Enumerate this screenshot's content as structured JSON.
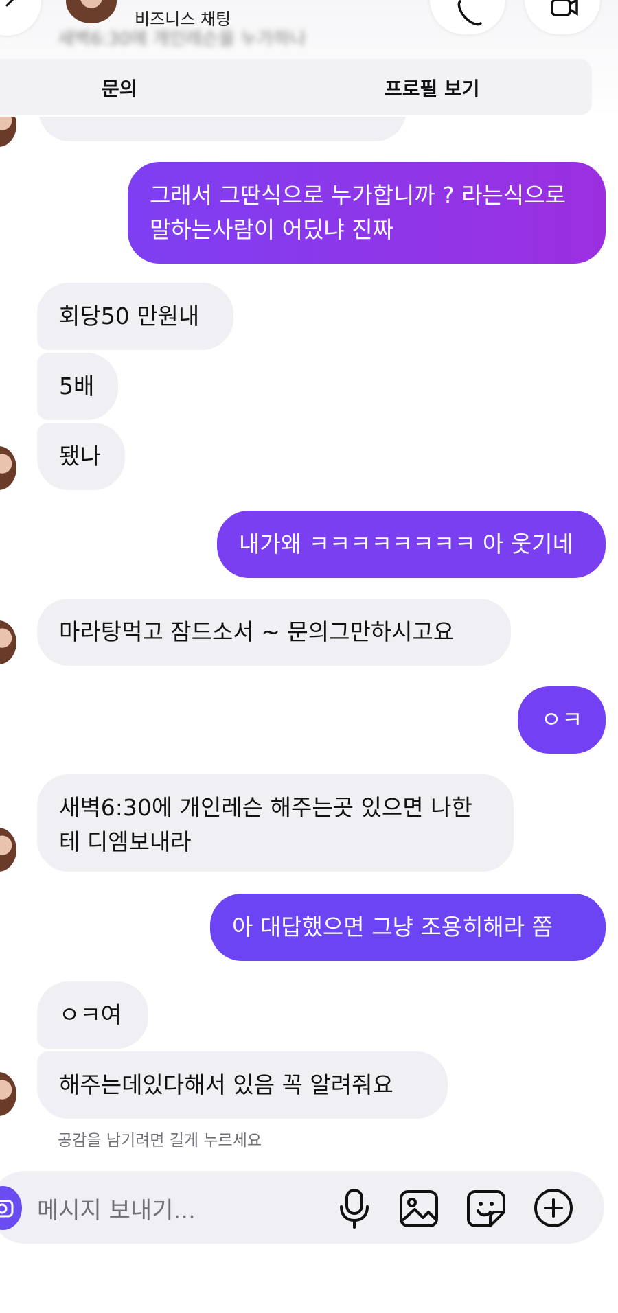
{
  "header": {
    "subtitle": "비즈니스 채팅",
    "blurred_preview": "새벽6:30에 개인레슨을 누가하나",
    "actions": {
      "inquiry": "문의",
      "profile": "프로필 보기"
    }
  },
  "messages": {
    "m1": "그래서 그딴식으로 누가합니까 ? 라는식으로 말하는사람이 어딨냐 진짜",
    "m2": "회당50 만원내",
    "m3": "5배",
    "m4": "됐나",
    "m5": "내가왜 ㅋㅋㅋㅋㅋㅋㅋㅋ 아 웃기네",
    "m6": "마라탕먹고 잠드소서 ~ 문의그만하시고요",
    "m7": "ㅇㅋ",
    "m8": "새벽6:30에 개인레슨 해주는곳 있으면 나한테 디엠보내라",
    "m9": "아 대답했으면 그냥 조용히해라 쫌",
    "m10": "ㅇㅋ여",
    "m11": "해주는데있다해서 있음 꼭 알려줘요"
  },
  "hint": "공감을 남기려면 길게 누르세요",
  "composer": {
    "placeholder": "메시지 보내기...",
    "icons": [
      "camera-icon",
      "microphone-icon",
      "image-icon",
      "sticker-icon",
      "add-icon"
    ]
  },
  "colors": {
    "outgoing_gradient_start": "#7e3ff2",
    "outgoing_gradient_end": "#9b2fe0",
    "outgoing_solid": "#7b3ff2",
    "incoming": "#efeff4",
    "composer_bg": "#f0f0f4"
  }
}
